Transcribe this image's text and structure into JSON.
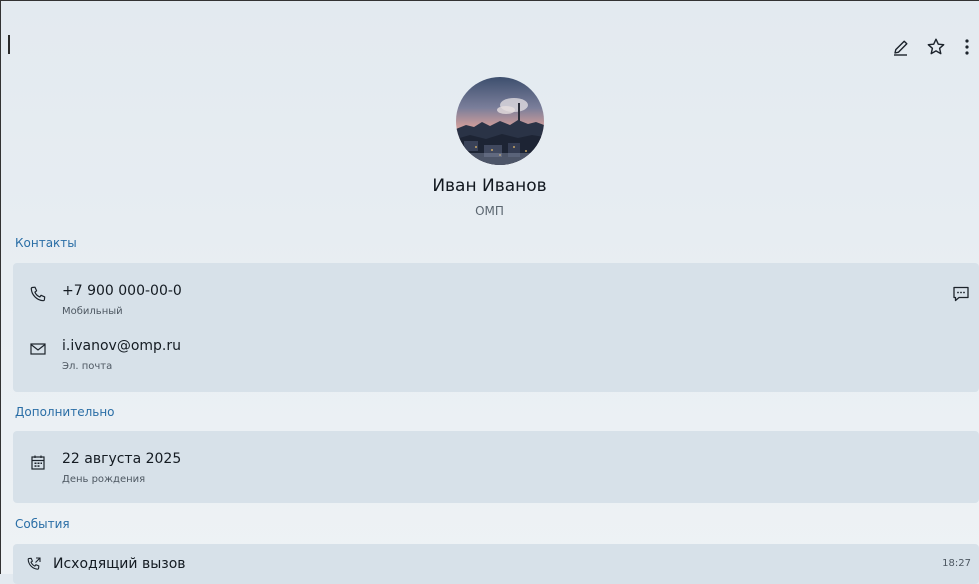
{
  "header": {
    "actions": [
      {
        "icon": "pencil-icon",
        "label": "edit"
      },
      {
        "icon": "star-outline-icon",
        "label": "favorite"
      },
      {
        "icon": "more-vertical-icon",
        "label": "more"
      }
    ]
  },
  "profile": {
    "name": "Иван Иванов",
    "organization": "ОМП",
    "avatar_icon": "city-dusk-photo"
  },
  "sections": {
    "contacts": {
      "title": "Контакты",
      "phone": {
        "value": "+7 900 000-00-0",
        "label": "Мобильный",
        "icon": "phone-icon",
        "action_icon": "message-icon"
      },
      "email": {
        "value": "i.ivanov@omp.ru",
        "label": "Эл. почта",
        "icon": "mail-icon"
      }
    },
    "additional": {
      "title": "Дополнительно",
      "birthday": {
        "value": "22 августа 2025",
        "label": "День рождения",
        "icon": "calendar-icon"
      }
    },
    "events": {
      "title": "События",
      "items": [
        {
          "label": "Исходящий вызов",
          "time": "18:27",
          "icon": "outgoing-call-icon"
        }
      ]
    }
  },
  "colors": {
    "accent": "#2a6ea6",
    "card_bg": "#d7e1e9",
    "page_bg": "#e7edf2"
  }
}
